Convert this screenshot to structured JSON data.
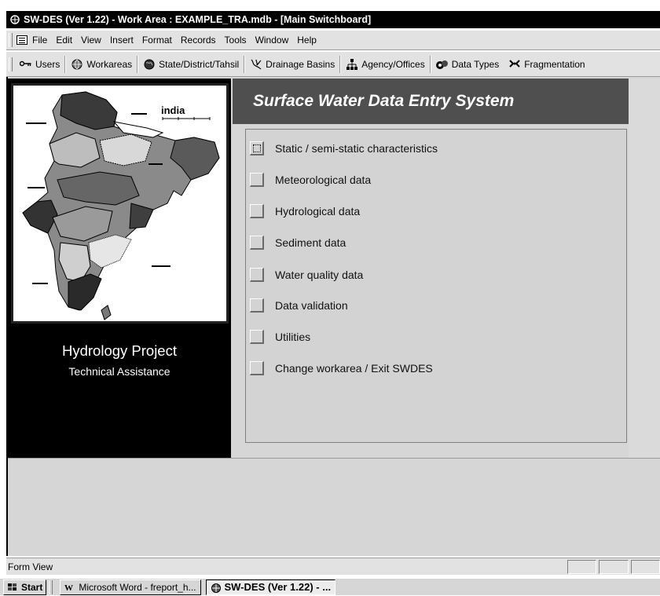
{
  "window": {
    "title": "SW-DES (Ver 1.22) - Work Area : EXAMPLE_TRA.mdb - [Main Switchboard]"
  },
  "menu": {
    "items": [
      "File",
      "Edit",
      "View",
      "Insert",
      "Format",
      "Records",
      "Tools",
      "Window",
      "Help"
    ]
  },
  "toolbar": {
    "items": [
      {
        "label": "Users",
        "icon": "key-icon"
      },
      {
        "label": "Workareas",
        "icon": "globe-icon"
      },
      {
        "label": "State/District/Tahsil",
        "icon": "globe-icon"
      },
      {
        "label": "Drainage Basins",
        "icon": "river-icon"
      },
      {
        "label": "Agency/Offices",
        "icon": "org-chart-icon"
      },
      {
        "label": "Data Types",
        "icon": "data-types-icon"
      },
      {
        "label": "Fragmentation",
        "icon": "fragmentation-icon"
      }
    ]
  },
  "map": {
    "title": "india"
  },
  "left_panel": {
    "title": "Hydrology Project",
    "subtitle": "Technical Assistance"
  },
  "header": {
    "title": "Surface Water Data Entry System"
  },
  "options": [
    {
      "label": "Static / semi-static characteristics",
      "focused": true
    },
    {
      "label": "Meteorological data",
      "focused": false
    },
    {
      "label": "Hydrological data",
      "focused": false
    },
    {
      "label": "Sediment data",
      "focused": false
    },
    {
      "label": "Water quality data",
      "focused": false
    },
    {
      "label": "Data validation",
      "focused": false
    },
    {
      "label": "Utilities",
      "focused": false
    },
    {
      "label": "Change workarea / Exit SWDES",
      "focused": false
    }
  ],
  "status": {
    "text": "Form View"
  },
  "taskbar": {
    "start_label": "Start",
    "tasks": [
      {
        "label": "Microsoft Word - freport_h...",
        "active": false
      },
      {
        "label": "SW-DES (Ver 1.22) - ...",
        "active": true
      }
    ]
  }
}
